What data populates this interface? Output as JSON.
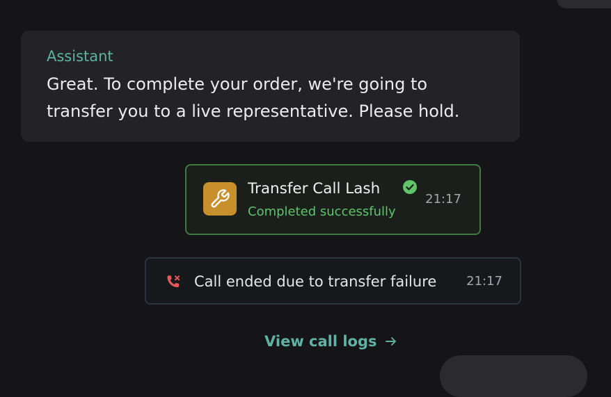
{
  "assistant_message": {
    "label": "Assistant",
    "text": "Great. To complete your order, we're going to transfer you to a live representative. Please hold."
  },
  "tool_call": {
    "title": "Transfer Call Lash",
    "status": "Completed successfully",
    "time": "21:17",
    "icon": "wrench-icon",
    "status_icon": "check-circle-icon",
    "accent_color": "#c8902c",
    "success_color": "#5fc46a",
    "border_color": "#3e7a44"
  },
  "call_event": {
    "text": "Call ended due to transfer failure",
    "time": "21:17",
    "icon": "phone-missed-icon",
    "icon_color": "#e85a5a"
  },
  "footer": {
    "view_logs_label": "View call logs",
    "arrow_icon": "arrow-right-icon",
    "link_color": "#5fb2a4"
  }
}
